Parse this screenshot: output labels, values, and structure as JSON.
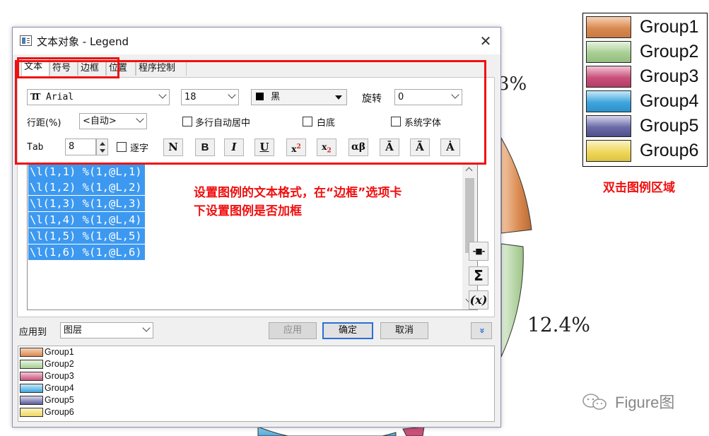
{
  "background": {
    "pie_labels": [
      "3%",
      "12.4%"
    ],
    "legend": {
      "items": [
        {
          "label": "Group1",
          "color": "#d9894f"
        },
        {
          "label": "Group2",
          "color": "#a8cf94"
        },
        {
          "label": "Group3",
          "color": "#c8507a"
        },
        {
          "label": "Group4",
          "color": "#3fa6de"
        },
        {
          "label": "Group5",
          "color": "#5a5a9a"
        },
        {
          "label": "Group6",
          "color": "#f0d85a"
        }
      ]
    },
    "legend_annotation": "双击图例区域",
    "watermark": "Figure图"
  },
  "dialog": {
    "title": "文本对象 - Legend",
    "tabs": [
      {
        "label": "文本",
        "active": true
      },
      {
        "label": "符号",
        "active": false
      },
      {
        "label": "边框",
        "active": false
      },
      {
        "label": "位置",
        "active": false
      },
      {
        "label": "程序控制",
        "active": false
      }
    ],
    "font": {
      "icon": "TT",
      "value": "Arial"
    },
    "font_size": "18",
    "color": {
      "swatch": "#000000",
      "label": "黑"
    },
    "rotation": {
      "label": "旋转",
      "value": "0"
    },
    "line_spacing": {
      "label": "行距(%)",
      "value": "<自动>"
    },
    "checkboxes": {
      "multiline_center": "多行自动居中",
      "white_bg": "白底",
      "system_font": "系统字体",
      "per_char": "逐字"
    },
    "tab_setting": {
      "label": "Tab",
      "value": "8"
    },
    "format_buttons": [
      "N",
      "B",
      "I",
      "U",
      "x2",
      "x2",
      "αβ",
      "Ā",
      "Ã",
      "Ȧ"
    ],
    "editor_lines": [
      "\\l(1,1) %(1,@L,1)",
      "\\l(1,2) %(1,@L,2)",
      "\\l(1,3) %(1,@L,3)",
      "\\l(1,4) %(1,@L,4)",
      "\\l(1,5) %(1,@L,5)",
      "\\l(1,6) %(1,@L,6)"
    ],
    "side_buttons": [
      "-■-",
      "Σ",
      "(x)"
    ],
    "apply_to": {
      "label": "应用到",
      "value": "图层"
    },
    "buttons": {
      "apply": "应用",
      "ok": "确定",
      "cancel": "取消",
      "expand": "»"
    },
    "preview_items": [
      "Group1",
      "Group2",
      "Group3",
      "Group4",
      "Group5",
      "Group6"
    ]
  },
  "annotation": {
    "line1": "设置图例的文本格式，在“边框”选项卡",
    "line2": "下设置图例是否加框"
  }
}
